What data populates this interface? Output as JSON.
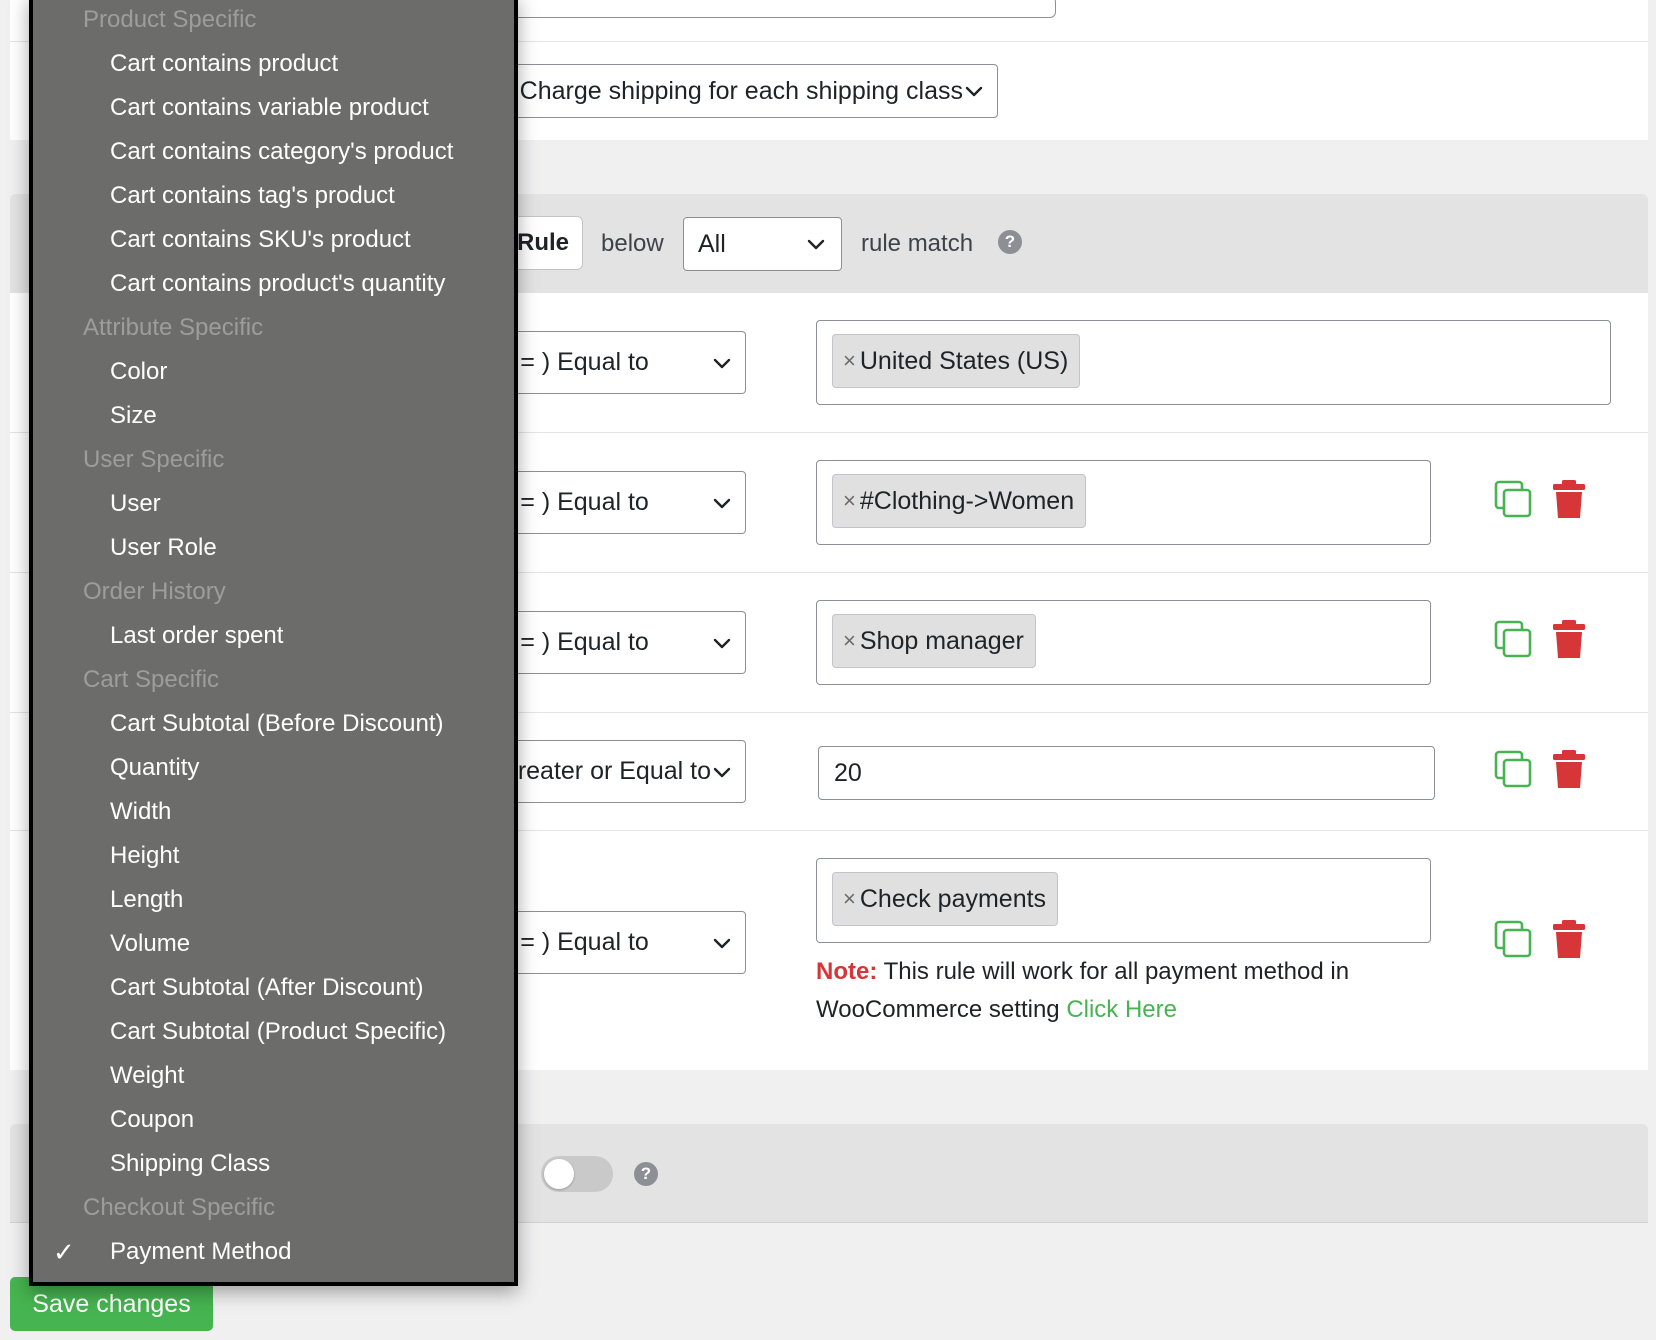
{
  "shipping_class_select": {
    "value": "Per class: Charge shipping for each shipping class"
  },
  "rules_header": {
    "button_label": "Rule",
    "below_label": "below",
    "match_select_value": "All",
    "rule_match_label": "rule match",
    "help_glyph": "?"
  },
  "rules": [
    {
      "operator": "Equal to ( = )",
      "tag": "United States (US)",
      "remove_glyph": "×"
    },
    {
      "operator": "Equal to ( = )",
      "tag": "#Clothing->Women",
      "remove_glyph": "×"
    },
    {
      "operator": "Equal to ( = )",
      "tag": "Shop manager",
      "remove_glyph": "×"
    },
    {
      "operator": "Greater or Equal to ( >= )",
      "value": "20"
    },
    {
      "operator": "Equal to ( = )",
      "tag": "Check payments",
      "remove_glyph": "×"
    }
  ],
  "note": {
    "label": "Note:",
    "text": " This rule will work for all payment method in WooCommerce setting ",
    "link": "Click Here"
  },
  "toggle_panel": {
    "help_glyph": "?"
  },
  "save_button": "Save changes",
  "dropdown": {
    "check_glyph": "✓",
    "groups": [
      {
        "label": "Product Specific",
        "items": [
          "Cart contains product",
          "Cart contains variable product",
          "Cart contains category's product",
          "Cart contains tag's product",
          "Cart contains SKU's product",
          "Cart contains product's quantity"
        ]
      },
      {
        "label": "Attribute Specific",
        "items": [
          "Color",
          "Size"
        ]
      },
      {
        "label": "User Specific",
        "items": [
          "User",
          "User Role"
        ]
      },
      {
        "label": "Order History",
        "items": [
          "Last order spent"
        ]
      },
      {
        "label": "Cart Specific",
        "items": [
          "Cart Subtotal (Before Discount)",
          "Quantity",
          "Width",
          "Height",
          "Length",
          "Volume",
          "Cart Subtotal (After Discount)",
          "Cart Subtotal (Product Specific)",
          "Weight",
          "Coupon",
          "Shipping Class"
        ]
      },
      {
        "label": "Checkout Specific",
        "items": [
          "Payment Method"
        ]
      }
    ],
    "selected": "Payment Method"
  },
  "colors": {
    "accent_green": "#46b450",
    "delete_red": "#d63638",
    "dropdown_bg": "#6c6d6b",
    "panel_gray": "#e3e3e3"
  },
  "icons": {
    "select_arrow": "chevron-down-icon",
    "duplicate": "copy-icon",
    "delete": "trash-icon",
    "help": "help-icon",
    "tag_remove": "close-icon",
    "selected_option": "checkmark-icon"
  }
}
